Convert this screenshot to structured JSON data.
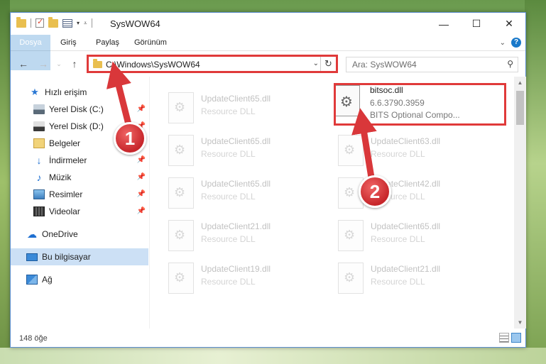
{
  "window": {
    "title": "SysWOW64"
  },
  "ribbon": {
    "tabs": [
      "Dosya",
      "Giriş",
      "Paylaş",
      "Görünüm"
    ],
    "help": "?"
  },
  "nav": {
    "address": "C:\\Windows\\SysWOW64",
    "search_placeholder": "Ara: SysWOW64"
  },
  "sidebar": {
    "items": [
      {
        "label": "Hızlı erişim",
        "icon": "star-icon"
      },
      {
        "label": "Yerel Disk (C:)",
        "icon": "drive-icon",
        "pinned": true
      },
      {
        "label": "Yerel Disk (D:)",
        "icon": "drive-icon",
        "pinned": true
      },
      {
        "label": "Belgeler",
        "icon": "documents-icon",
        "pinned": true
      },
      {
        "label": "İndirmeler",
        "icon": "download-icon",
        "pinned": true
      },
      {
        "label": "Müzik",
        "icon": "music-icon",
        "pinned": true
      },
      {
        "label": "Resimler",
        "icon": "pictures-icon",
        "pinned": true
      },
      {
        "label": "Videolar",
        "icon": "videos-icon",
        "pinned": true
      },
      {
        "label": "OneDrive",
        "icon": "cloud-icon"
      },
      {
        "label": "Bu bilgisayar",
        "icon": "computer-icon",
        "selected": true
      },
      {
        "label": "Ağ",
        "icon": "network-icon"
      }
    ]
  },
  "files": {
    "col1": [
      {
        "name": "UpdateClient65.dll",
        "desc": "Resource DLL"
      },
      {
        "name": "UpdateClient65.dll",
        "desc": "Resource DLL"
      },
      {
        "name": "UpdateClient65.dll",
        "desc": "Resource DLL"
      },
      {
        "name": "UpdateClient21.dll",
        "desc": "Resource DLL"
      },
      {
        "name": "UpdateClient19.dll",
        "desc": "Resource DLL"
      }
    ],
    "col2": [
      {
        "name": "UpdateClient63.dll",
        "desc": "Resource DLL"
      },
      {
        "name": "UpdateClient42.dll",
        "desc": "Resource DLL"
      },
      {
        "name": "UpdateClient65.dll",
        "desc": "Resource DLL"
      },
      {
        "name": "UpdateClient21.dll",
        "desc": "Resource DLL"
      }
    ],
    "highlight": {
      "name": "bitsoc.dll",
      "version": "6.6.3790.3959",
      "desc": "BITS Optional Compo..."
    }
  },
  "status": {
    "count": "148 öğe"
  },
  "annotations": {
    "step1": "1",
    "step2": "2"
  },
  "colors": {
    "accent": "#1979ca",
    "highlight": "#e03a3a"
  }
}
